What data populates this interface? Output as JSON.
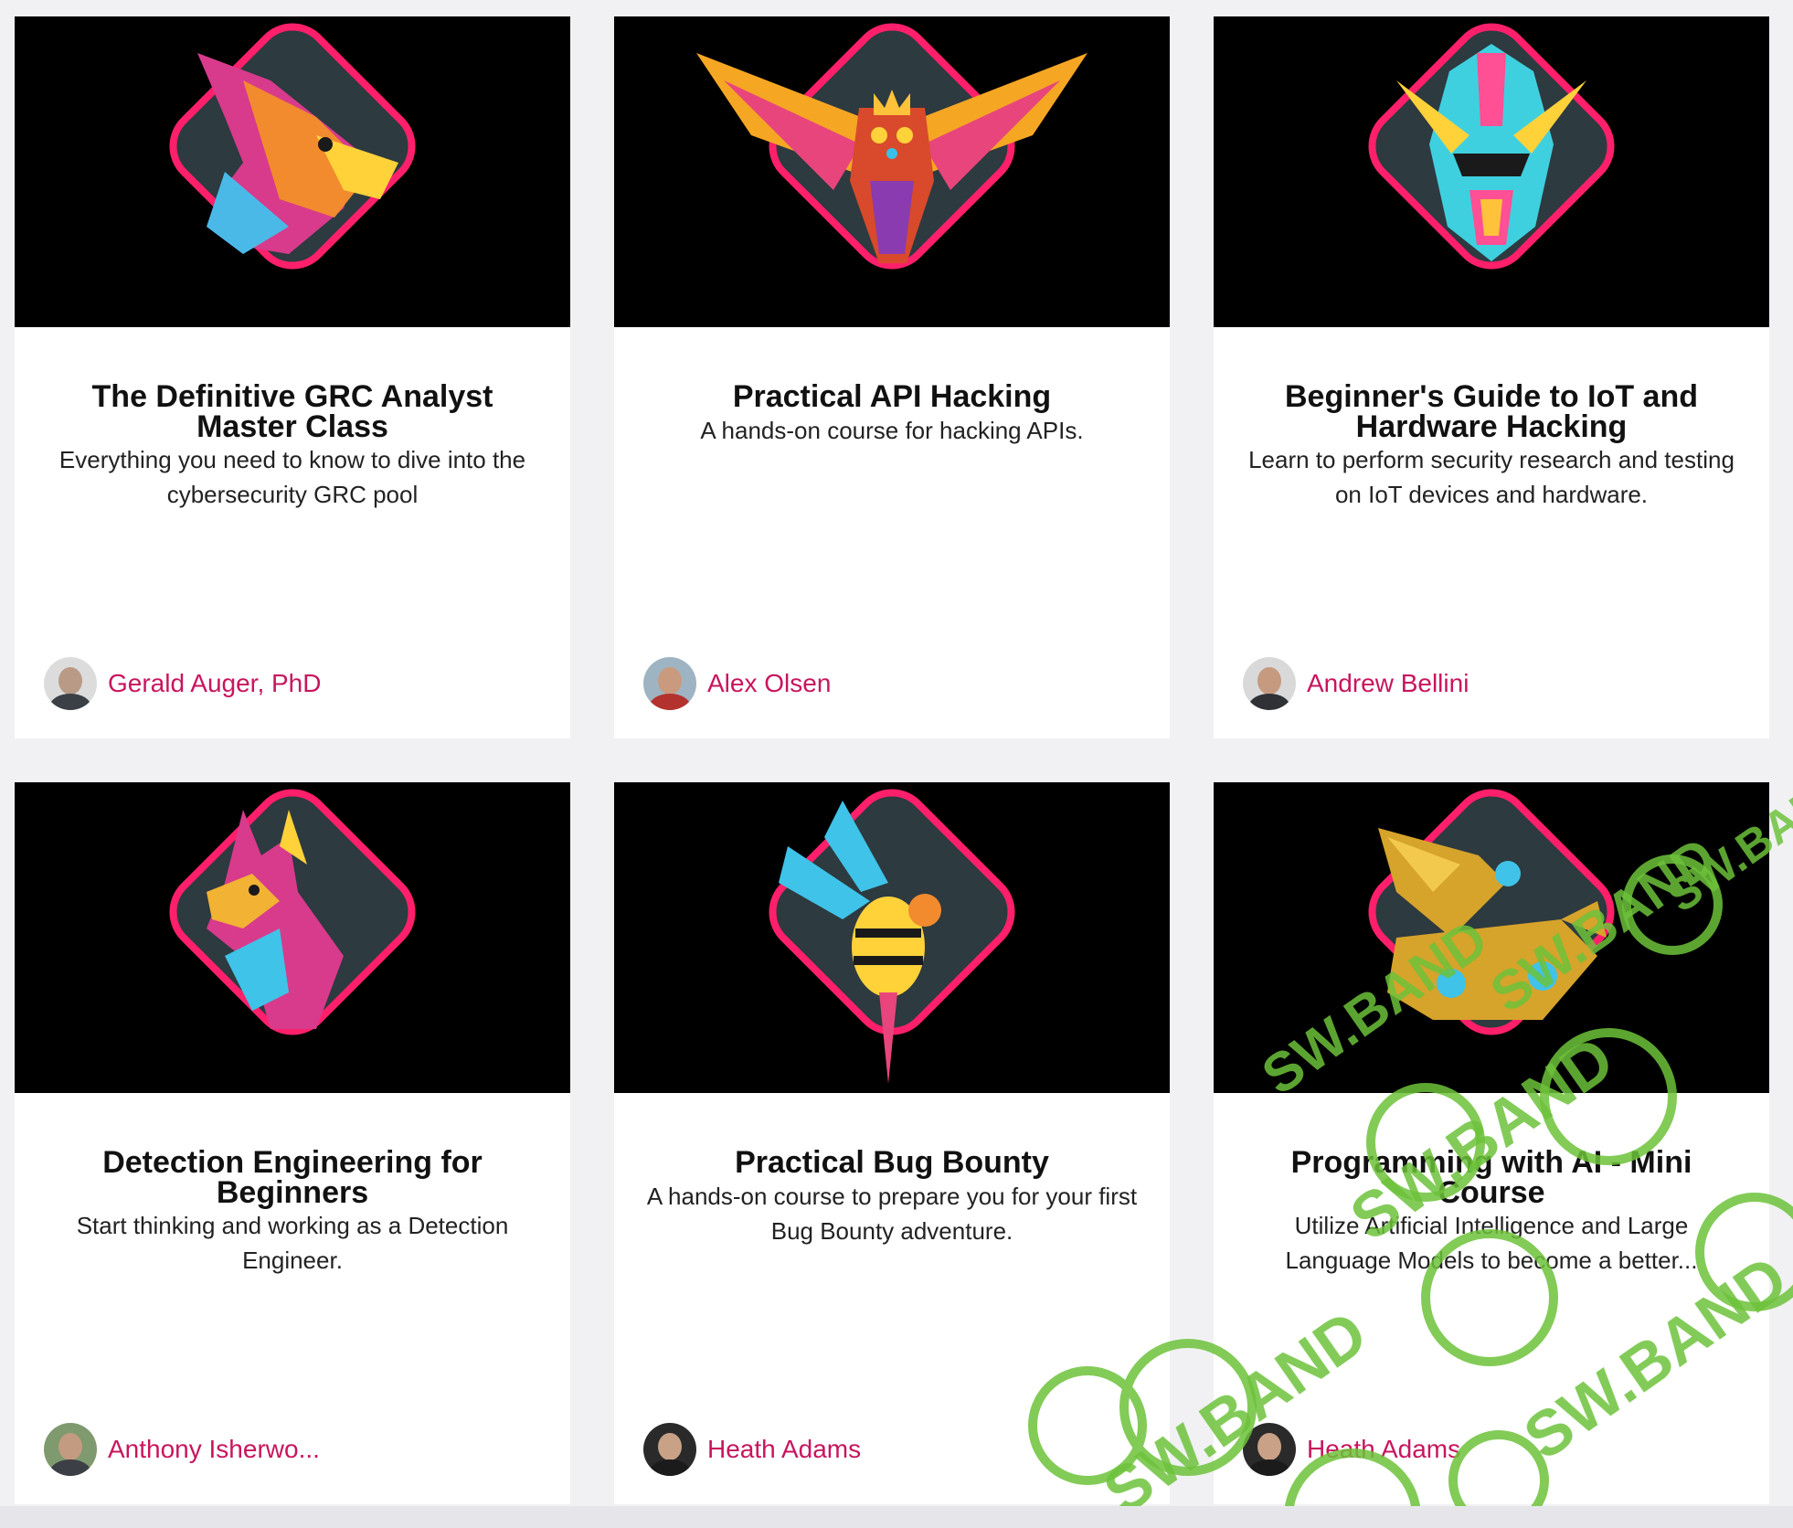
{
  "courses": [
    {
      "title": "The Definitive GRC Analyst Master Class",
      "subtitle": "Everything you need to know to dive into the cybersecurity GRC pool",
      "author": "Gerald Auger, PhD",
      "mascot": "phoenix-head-icon"
    },
    {
      "title": "Practical API Hacking",
      "subtitle": "A hands-on course for hacking APIs.",
      "author": "Alex Olsen",
      "mascot": "owl-icon"
    },
    {
      "title": "Beginner's Guide to IoT and Hardware Hacking",
      "subtitle": "Learn to perform security research and testing on IoT devices and hardware.",
      "author": "Andrew Bellini",
      "mascot": "robot-helmet-icon"
    },
    {
      "title": "Detection Engineering for Beginners",
      "subtitle": "Start thinking and working as a Detection Engineer.",
      "author": "Anthony Isherwo...",
      "mascot": "dragon-head-icon"
    },
    {
      "title": "Practical Bug Bounty",
      "subtitle": "A hands-on course to prepare you for your first Bug Bounty adventure.",
      "author": "Heath Adams",
      "mascot": "wasp-icon"
    },
    {
      "title": "Programming with AI - Mini Course",
      "subtitle": "Utilize Artificial Intelligence and Large Language Models to become a better...",
      "author": "Heath Adams",
      "mascot": "mechanical-griffin-icon"
    }
  ],
  "watermark": "SW.BAND",
  "colors": {
    "author_link": "#c8155e",
    "badge_glow": "#ff1f6b",
    "badge_fill": "#2d3a3f",
    "watermark": "#6dc23a"
  }
}
